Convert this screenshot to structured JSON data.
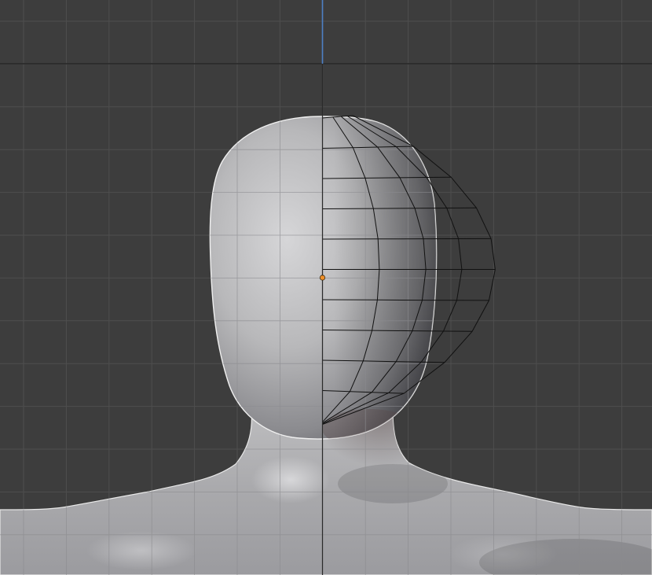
{
  "viewport": {
    "background_color": "#3d3d3d",
    "grid_color": "#4e4e4e",
    "horizon_line_color": "#262626",
    "z_axis_color": "#4d80c4",
    "model_color": "#b4b4b6",
    "wireframe_color": "#111111",
    "origin_color": "#f0902a"
  },
  "scene": {
    "object": "human-base-mesh",
    "view": "front",
    "modifiers": [
      "mirror",
      "subdivision-surface"
    ],
    "wireframe_overlay": true,
    "origin_marker_visible": true,
    "grid_visible": true
  }
}
